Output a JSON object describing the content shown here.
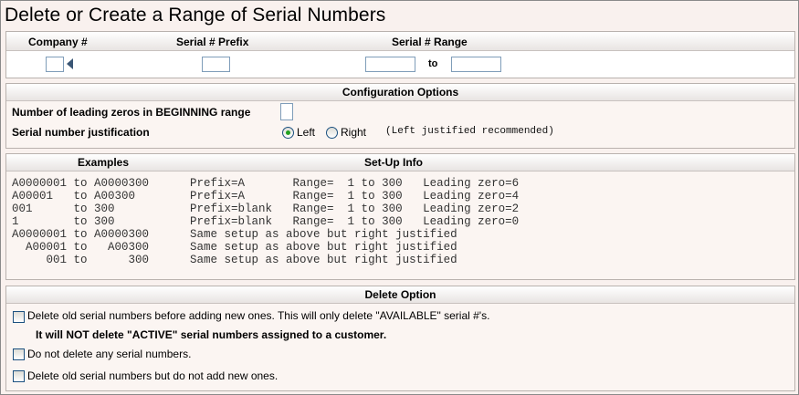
{
  "page": {
    "title": "Delete or Create a Range of Serial Numbers"
  },
  "range": {
    "company_label": "Company #",
    "prefix_label": "Serial # Prefix",
    "range_label": "Serial # Range",
    "to_label": "to",
    "company_value": "",
    "prefix_value": "",
    "range_from_value": "",
    "range_to_value": ""
  },
  "config": {
    "header": "Configuration Options",
    "leading_zeros_label": "Number of leading zeros in BEGINNING range",
    "leading_zeros_value": "",
    "justification_label": "Serial number justification",
    "justification_options": [
      "Left",
      "Right"
    ],
    "justification_selected": "Left",
    "justification_note": "(Left justified recommended)"
  },
  "examples": {
    "header_examples": "Examples",
    "header_setup": "Set-Up Info",
    "rows": [
      "A0000001 to A0000300      Prefix=A       Range=  1 to 300   Leading zero=6",
      "A00001   to A00300        Prefix=A       Range=  1 to 300   Leading zero=4",
      "001      to 300           Prefix=blank   Range=  1 to 300   Leading zero=2",
      "1        to 300           Prefix=blank   Range=  1 to 300   Leading zero=0",
      "A0000001 to A0000300      Same setup as above but right justified",
      "  A00001 to   A00300      Same setup as above but right justified",
      "     001 to      300      Same setup as above but right justified"
    ]
  },
  "delete_option": {
    "header": "Delete Option",
    "opt1_label": "Delete old serial numbers before adding new ones. This will only delete \"AVAILABLE\" serial #'s.",
    "opt1_warning": "It will NOT delete \"ACTIVE\" serial numbers assigned to a customer.",
    "opt2_label": "Do not delete any serial numbers.",
    "opt3_label": "Delete old serial numbers but do not add new ones."
  }
}
